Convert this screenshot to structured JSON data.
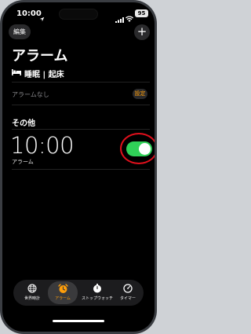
{
  "status": {
    "time": "10:00",
    "battery": "95"
  },
  "header": {
    "edit_label": "編集",
    "add_label": "+"
  },
  "title": "アラーム",
  "sleep": {
    "label": "睡眠 | 起床",
    "no_alarm": "アラームなし",
    "settings_label": "設定"
  },
  "section_other": "その他",
  "alarm": {
    "time": "10:00",
    "label": "アラーム",
    "enabled": true
  },
  "colors": {
    "accent": "#ff9f0a",
    "toggle_on": "#30d158",
    "highlight_ring": "#e0101c"
  },
  "tabs": [
    {
      "label": "世界時計",
      "icon": "globe-icon"
    },
    {
      "label": "アラーム",
      "icon": "alarm-clock-icon",
      "active": true
    },
    {
      "label": "ストップウォッチ",
      "icon": "stopwatch-icon"
    },
    {
      "label": "タイマー",
      "icon": "timer-icon"
    }
  ]
}
